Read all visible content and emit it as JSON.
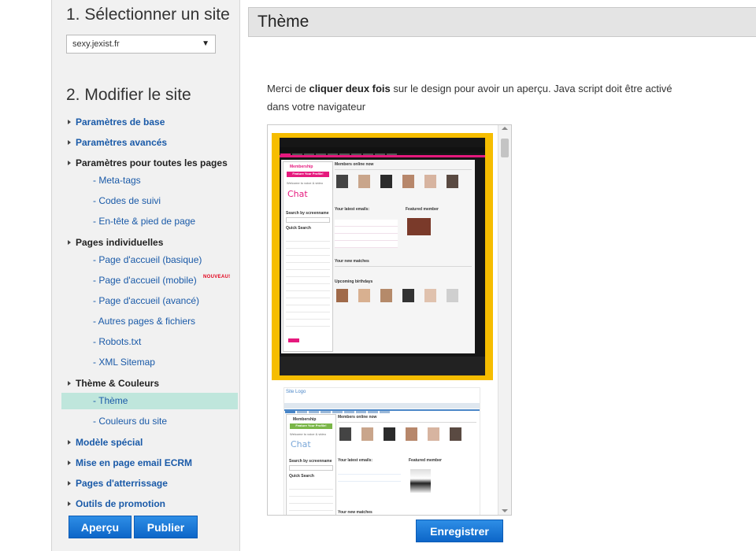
{
  "sidebar": {
    "step1_title": "1. Sélectionner un site",
    "site_select_value": "sexy.jexist.fr",
    "step2_title": "2. Modifier le site",
    "items": {
      "base": "Paramètres de base",
      "advanced": "Paramètres avancés",
      "all_pages": "Paramètres pour toutes les pages",
      "meta_tags": "- Meta-tags",
      "tracking_codes": "- Codes de suivi",
      "header_footer": "- En-tête & pied de page",
      "individual_pages": "Pages individuelles",
      "home_basic": "- Page d'accueil (basique)",
      "home_mobile": "- Page d'accueil (mobile)",
      "new_badge": "NOUVEAU!",
      "home_advanced": "- Page d'accueil (avancé)",
      "other_pages": "- Autres pages & fichiers",
      "robots": "- Robots.txt",
      "sitemap": "- XML Sitemap",
      "theme_colors": "Thème & Couleurs",
      "theme": "- Thème",
      "site_colors": "- Couleurs du site",
      "special_model": "Modèle spécial",
      "email_layout": "Mise en page email ECRM",
      "landing_pages": "Pages d'atterrissage",
      "promo_tools": "Outils de promotion"
    },
    "preview_button": "Aperçu",
    "publish_button": "Publier"
  },
  "main": {
    "header_title": "Thème",
    "intro_before": "Merci de ",
    "intro_bold": "cliquer deux fois",
    "intro_after": " sur le design pour avoir un aperçu. Java script doit être activé dans votre navigateur",
    "save_button": "Enregistrer"
  },
  "preview": {
    "theme1": {
      "membership": "Membership",
      "feature": "Feature Your Profile!",
      "welcome": "Welcome to voice & video",
      "chat": "Chat",
      "members_online": "Members online now",
      "latest_emails": "Your latest emails:",
      "featured_member": "Featured member",
      "new_matches": "Your new matches",
      "birthdays": "Upcoming birthdays",
      "search_screenname": "Search by screenname",
      "quick_search": "Quick Search"
    },
    "theme2": {
      "site_logo": "Site Logo",
      "membership": "Membership",
      "feature": "Feature Your Profile!",
      "welcome": "Welcome to voice & video",
      "chat": "Chat",
      "members_online": "Members online now",
      "latest_emails": "Your latest emails:",
      "featured_member": "Featured member",
      "search_screenname": "Search by screenname",
      "quick_search": "Quick Search",
      "new_matches": "Your new matches"
    }
  },
  "colors": {
    "theme1_frame": "#f6bd00",
    "theme1_accent": "#e5197d",
    "theme2_accent": "#4a86c7",
    "active_item_bg": "#bfe6dc",
    "button_blue": "#1a78d8",
    "badge_red": "#e2001a"
  }
}
